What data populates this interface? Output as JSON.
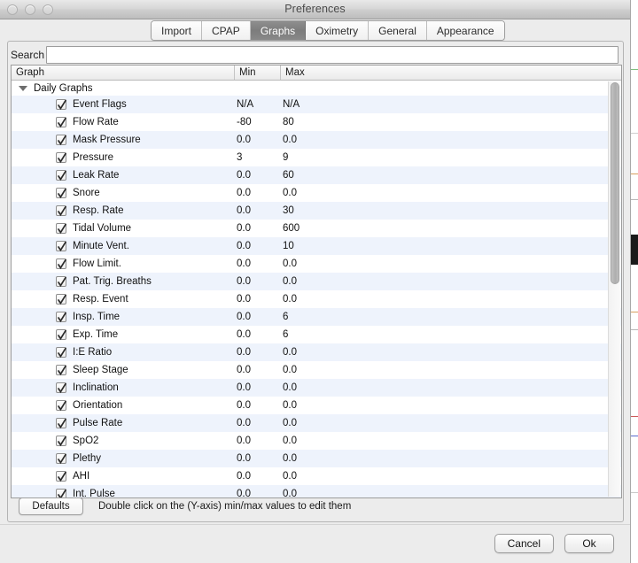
{
  "window": {
    "title": "Preferences",
    "traffic_lights": [
      "close-button",
      "minimize-button",
      "zoom-button"
    ]
  },
  "tabs": [
    {
      "label": "Import",
      "selected": false
    },
    {
      "label": "CPAP",
      "selected": false
    },
    {
      "label": "Graphs",
      "selected": true
    },
    {
      "label": "Oximetry",
      "selected": false
    },
    {
      "label": "General",
      "selected": false
    },
    {
      "label": "Appearance",
      "selected": false
    }
  ],
  "search": {
    "label": "Search",
    "value": "",
    "placeholder": ""
  },
  "table": {
    "columns": [
      "Graph",
      "Min",
      "Max"
    ],
    "group": {
      "label": "Daily Graphs",
      "expanded": true
    },
    "rows": [
      {
        "checked": true,
        "graph": "Event Flags",
        "min": "N/A",
        "max": "N/A"
      },
      {
        "checked": true,
        "graph": "Flow Rate",
        "min": "-80",
        "max": "80"
      },
      {
        "checked": true,
        "graph": "Mask Pressure",
        "min": "0.0",
        "max": "0.0"
      },
      {
        "checked": true,
        "graph": "Pressure",
        "min": "3",
        "max": "9"
      },
      {
        "checked": true,
        "graph": "Leak Rate",
        "min": "0.0",
        "max": "60"
      },
      {
        "checked": true,
        "graph": "Snore",
        "min": "0.0",
        "max": "0.0"
      },
      {
        "checked": true,
        "graph": "Resp. Rate",
        "min": "0.0",
        "max": "30"
      },
      {
        "checked": true,
        "graph": "Tidal Volume",
        "min": "0.0",
        "max": "600"
      },
      {
        "checked": true,
        "graph": "Minute Vent.",
        "min": "0.0",
        "max": "10"
      },
      {
        "checked": true,
        "graph": "Flow Limit.",
        "min": "0.0",
        "max": "0.0"
      },
      {
        "checked": true,
        "graph": "Pat. Trig. Breaths",
        "min": "0.0",
        "max": "0.0"
      },
      {
        "checked": true,
        "graph": "Resp. Event",
        "min": "0.0",
        "max": "0.0"
      },
      {
        "checked": true,
        "graph": "Insp. Time",
        "min": "0.0",
        "max": "6"
      },
      {
        "checked": true,
        "graph": "Exp. Time",
        "min": "0.0",
        "max": "6"
      },
      {
        "checked": true,
        "graph": "I:E Ratio",
        "min": "0.0",
        "max": "0.0"
      },
      {
        "checked": true,
        "graph": "Sleep Stage",
        "min": "0.0",
        "max": "0.0"
      },
      {
        "checked": true,
        "graph": "Inclination",
        "min": "0.0",
        "max": "0.0"
      },
      {
        "checked": true,
        "graph": "Orientation",
        "min": "0.0",
        "max": "0.0"
      },
      {
        "checked": true,
        "graph": "Pulse Rate",
        "min": "0.0",
        "max": "0.0"
      },
      {
        "checked": true,
        "graph": "SpO2",
        "min": "0.0",
        "max": "0.0"
      },
      {
        "checked": true,
        "graph": "Plethy",
        "min": "0.0",
        "max": "0.0"
      },
      {
        "checked": true,
        "graph": "AHI",
        "min": "0.0",
        "max": "0.0"
      },
      {
        "checked": true,
        "graph": "Int. Pulse",
        "min": "0.0",
        "max": "0.0"
      }
    ]
  },
  "panel_bottom": {
    "defaults_label": "Defaults",
    "hint": "Double click on the (Y-axis) min/max values to edit them"
  },
  "footer": {
    "cancel_label": "Cancel",
    "ok_label": "Ok"
  },
  "colors": {
    "selected_tab_bg": "#828282",
    "row_alt_bg": "#eef3fc",
    "row_bg": "#ffffff",
    "panel_bg": "#ececec",
    "titlebar_text": "#4a4a4a"
  }
}
